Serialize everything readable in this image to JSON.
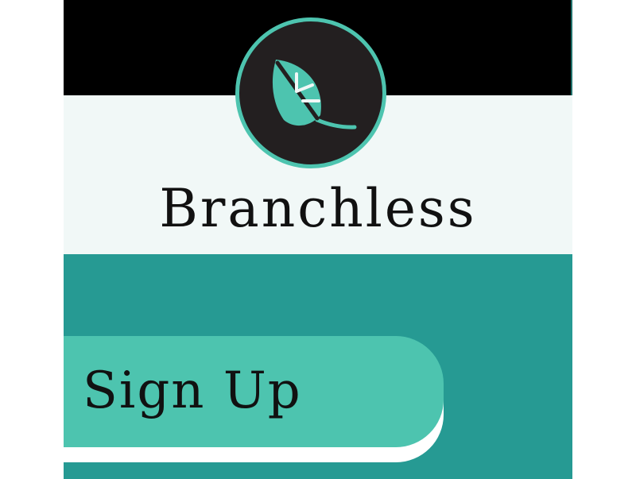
{
  "brand": {
    "name": "Branchless",
    "logo_icon": "leaf-icon"
  },
  "signup": {
    "label": "Sign Up"
  },
  "colors": {
    "top_bar": "#000000",
    "header_background": "#f1f8f7",
    "main_background": "#269a93",
    "accent": "#4dc4af",
    "logo_background": "#231f20"
  }
}
